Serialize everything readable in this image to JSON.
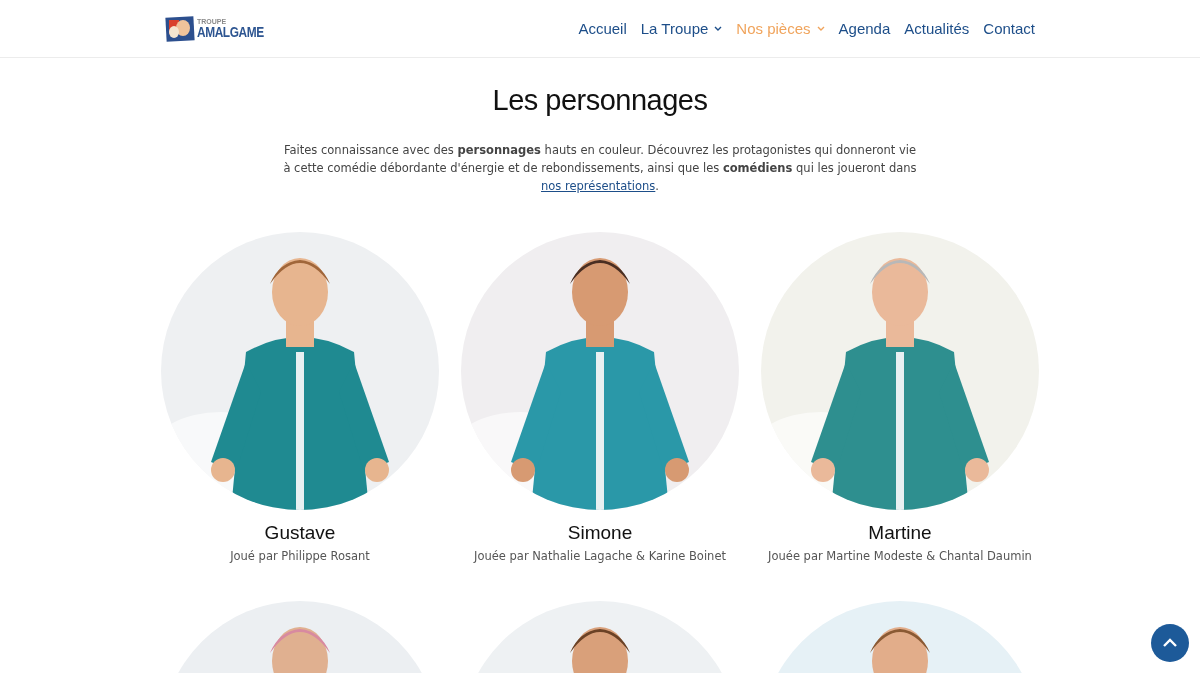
{
  "header": {
    "logo": {
      "top": "TROUPE",
      "bottom": "AMALGAME"
    },
    "nav": [
      {
        "label": "Accueil",
        "selected": false,
        "dropdown": false
      },
      {
        "label": "La Troupe",
        "selected": false,
        "dropdown": true
      },
      {
        "label": "Nos pièces",
        "selected": true,
        "dropdown": true
      },
      {
        "label": "Agenda",
        "selected": false,
        "dropdown": false
      },
      {
        "label": "Actualités",
        "selected": false,
        "dropdown": false
      },
      {
        "label": "Contact",
        "selected": false,
        "dropdown": false
      }
    ]
  },
  "title": "Les personnages",
  "intro": {
    "text": "Faites connaissance avec des **personnages** hauts en couleur. Découvrez les protagonistes qui donneront vie à cette comédie débordante d'énergie et de rebondissements, ainsi que les **comédiens** qui les joueront dans ",
    "link": "nos représentations",
    "after": "."
  },
  "characters": [
    {
      "kind": "picture",
      "name": "Gustave",
      "played_by": "Joué par Philippe Rosant"
    },
    {
      "kind": "picture",
      "name": "Simone",
      "played_by": "Jouée par Nathalie Lagache & Karine Boinet"
    },
    {
      "kind": "picture",
      "name": "Martine",
      "played_by": "Jouée par Martine Modeste & Chantal Daumin"
    },
    {
      "kind": "picture"
    },
    {
      "kind": "picture"
    },
    {
      "kind": "picture"
    }
  ]
}
